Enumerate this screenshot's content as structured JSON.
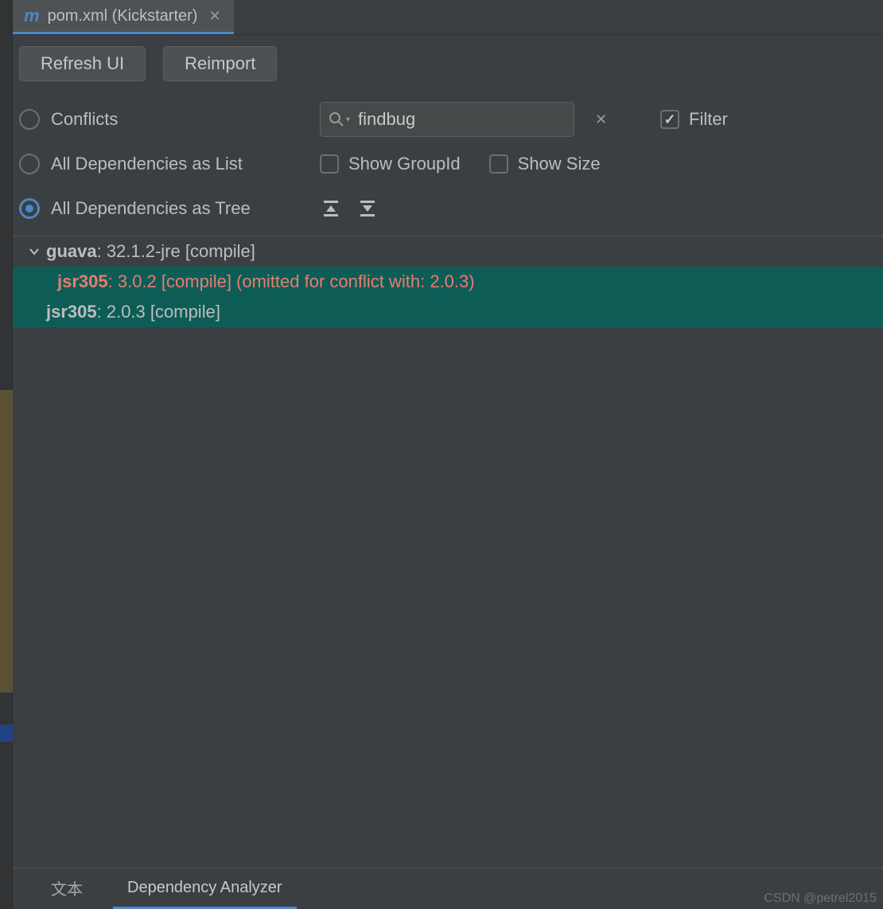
{
  "tab": {
    "title": "pom.xml (Kickstarter)"
  },
  "toolbar": {
    "refresh_label": "Refresh UI",
    "reimport_label": "Reimport"
  },
  "view_options": {
    "conflicts_label": "Conflicts",
    "all_list_label": "All Dependencies as List",
    "all_tree_label": "All Dependencies as Tree",
    "selected": "tree"
  },
  "search": {
    "value": "findbug"
  },
  "checks": {
    "filter_label": "Filter",
    "filter_checked": true,
    "show_groupid_label": "Show GroupId",
    "show_groupid_checked": false,
    "show_size_label": "Show Size",
    "show_size_checked": false
  },
  "tree": [
    {
      "artifact": "guava",
      "rest": " : 32.1.2-jre [compile]",
      "depth": 0,
      "expanded": true,
      "selected": false,
      "conflict": false
    },
    {
      "artifact": "jsr305",
      "rest": " : 3.0.2 [compile] (omitted for conflict with: 2.0.3)",
      "depth": 1,
      "expanded": null,
      "selected": true,
      "conflict": true
    },
    {
      "artifact": "jsr305",
      "rest": " : 2.0.3 [compile]",
      "depth": 0,
      "expanded": null,
      "selected": true,
      "conflict": false
    }
  ],
  "bottom_tabs": {
    "text_label": "文本",
    "analyzer_label": "Dependency Analyzer"
  },
  "watermark": "CSDN @petrel2015"
}
